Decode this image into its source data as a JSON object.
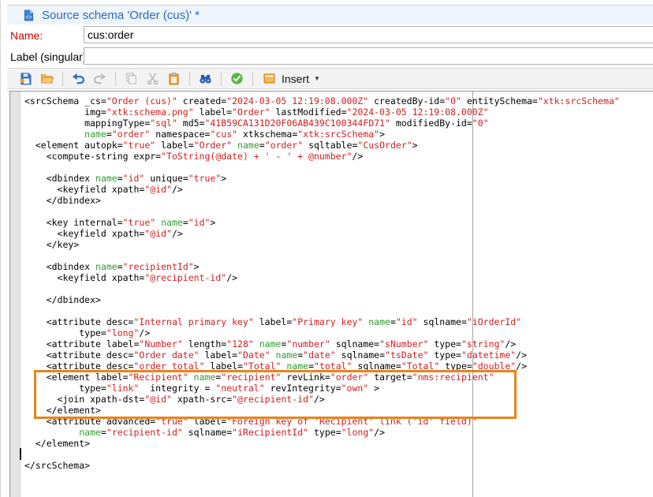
{
  "tab": {
    "icon": "schema-file-icon",
    "title": "Source schema 'Order (cus)' *"
  },
  "fields": {
    "name": {
      "label": "Name:",
      "value": "cus:order"
    },
    "label_singular": {
      "label": "Label (singular):",
      "value": ""
    }
  },
  "toolbar": {
    "groups": [
      [
        {
          "id": "save",
          "icon": "save-icon",
          "enabled": true
        },
        {
          "id": "open",
          "icon": "folder-open-icon",
          "enabled": true
        }
      ],
      [
        {
          "id": "undo",
          "icon": "undo-icon",
          "enabled": true
        },
        {
          "id": "redo",
          "icon": "redo-icon",
          "enabled": false
        }
      ],
      [
        {
          "id": "copy",
          "icon": "copy-icon",
          "enabled": false
        },
        {
          "id": "cut",
          "icon": "scissors-icon",
          "enabled": false
        },
        {
          "id": "paste",
          "icon": "paste-clipboard-icon",
          "enabled": true
        }
      ],
      [
        {
          "id": "search",
          "icon": "binoculars-icon",
          "enabled": true
        }
      ],
      [
        {
          "id": "validate",
          "icon": "check-circle-icon",
          "enabled": true
        }
      ]
    ],
    "insert_button": {
      "label": "Insert",
      "icon": "insert-window-icon",
      "has_dropdown": true
    }
  },
  "editor": {
    "colors": {
      "attr_value": "#cc2121",
      "name_attribute": "#2f9b2f",
      "default_text": "#000000",
      "highlight_border": "#e8831d",
      "guide_line": "#a3a3a3"
    },
    "highlighted_region": "element Recipient link block",
    "code_lines": [
      "<srcSchema _cs=\"Order (cus)\" created=\"2024-03-05 12:19:08.000Z\" createdBy-id=\"0\" entitySchema=\"xtk:srcSchema\"",
      "           img=\"xtk:schema.png\" label=\"Order\" lastModified=\"2024-03-05 12:19:08.000Z\"",
      "           mappingType=\"sql\" md5=\"41B59CA131D20F06AB439C100344FD71\" modifiedBy-id=\"0\"",
      "           name=\"order\" namespace=\"cus\" xtkschema=\"xtk:srcSchema\">",
      "  <element autopk=\"true\" label=\"Order\" name=\"order\" sqltable=\"CusOrder\">",
      "    <compute-string expr=\"ToString(@date) + ' - ' + @number\"/>",
      "",
      "    <dbindex name=\"id\" unique=\"true\">",
      "      <keyfield xpath=\"@id\"/>",
      "    </dbindex>",
      "",
      "    <key internal=\"true\" name=\"id\">",
      "      <keyfield xpath=\"@id\"/>",
      "    </key>",
      "",
      "    <dbindex name=\"recipientId\">",
      "      <keyfield xpath=\"@recipient-id\"/>",
      "",
      "    </dbindex>",
      "",
      "    <attribute desc=\"Internal primary key\" label=\"Primary key\" name=\"id\" sqlname=\"iOrderId\"",
      "          type=\"long\"/>",
      "    <attribute label=\"Number\" length=\"128\" name=\"number\" sqlname=\"sNumber\" type=\"string\"/>",
      "    <attribute desc=\"Order date\" label=\"Date\" name=\"date\" sqlname=\"tsDate\" type=\"datetime\"/>",
      "    <attribute desc=\"order total\" label=\"Total\" name=\"total\" sqlname=\"Total\" type=\"double\"/>",
      "    <element label=\"Recipient\" name=\"recipient\" revLink=\"order\" target=\"nms:recipient\"",
      "          type=\"link\"  integrity = \"neutral\" revIntegrity=\"own\" >",
      "      <join xpath-dst=\"@id\" xpath-src=\"@recipient-id\"/>",
      "    </element>",
      "    <attribute advanced=\"true\" label=\"Foreign key of 'Recipient' link ('id' field)\"",
      "          name=\"recipient-id\" sqlname=\"iRecipientId\" type=\"long\"/>",
      "  </element>",
      "",
      "</srcSchema>"
    ]
  }
}
